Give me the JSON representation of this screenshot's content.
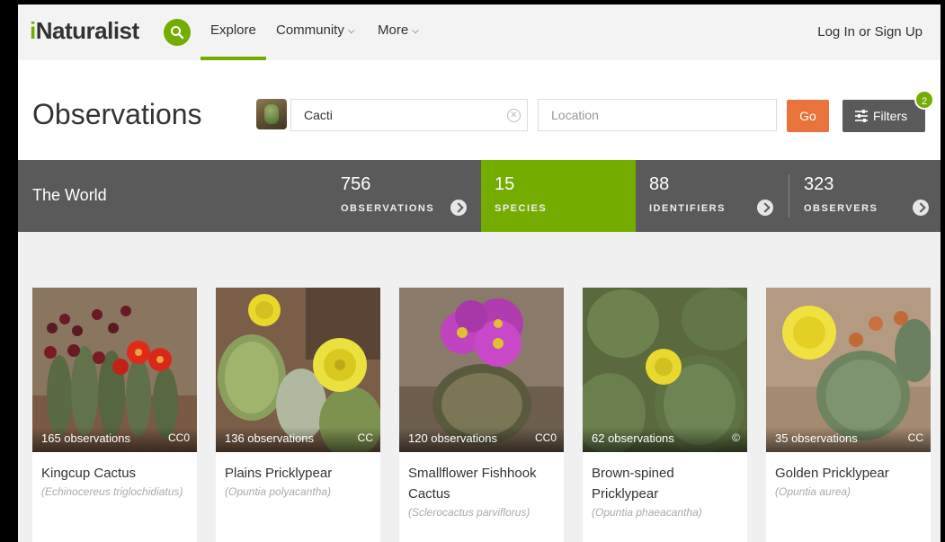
{
  "nav": {
    "logo_i": "i",
    "logo_rest": "Naturalist",
    "explore": "Explore",
    "community": "Community",
    "more": "More",
    "login": "Log In or Sign Up"
  },
  "header": {
    "title": "Observations",
    "taxon_value": "Cacti",
    "location_placeholder": "Location",
    "go_label": "Go",
    "filters_label": "Filters",
    "filters_count": "2"
  },
  "stats": {
    "place": "The World",
    "observations": {
      "number": "756",
      "label": "OBSERVATIONS"
    },
    "species": {
      "number": "15",
      "label": "SPECIES"
    },
    "identifiers": {
      "number": "88",
      "label": "IDENTIFIERS"
    },
    "observers": {
      "number": "323",
      "label": "OBSERVERS"
    }
  },
  "cards": [
    {
      "count": "165 observations",
      "license": "CC0",
      "name": "Kingcup Cactus",
      "sci": "(Echinocereus triglochidiatus)"
    },
    {
      "count": "136 observations",
      "license": "CC",
      "name": "Plains Pricklypear",
      "sci": "(Opuntia polyacantha)"
    },
    {
      "count": "120 observations",
      "license": "CC0",
      "name": "Smallflower Fishhook Cactus",
      "sci": "(Sclerocactus parviflorus)"
    },
    {
      "count": "62 observations",
      "license": "©",
      "name": "Brown-spined Pricklypear",
      "sci": "(Opuntia phaeacantha)"
    },
    {
      "count": "35 observations",
      "license": "CC",
      "name": "Golden Pricklypear",
      "sci": "(Opuntia aurea)"
    }
  ],
  "colors": {
    "brand_green": "#74ac00",
    "go_orange": "#e8743b",
    "stats_gray": "#5a5a5a"
  }
}
